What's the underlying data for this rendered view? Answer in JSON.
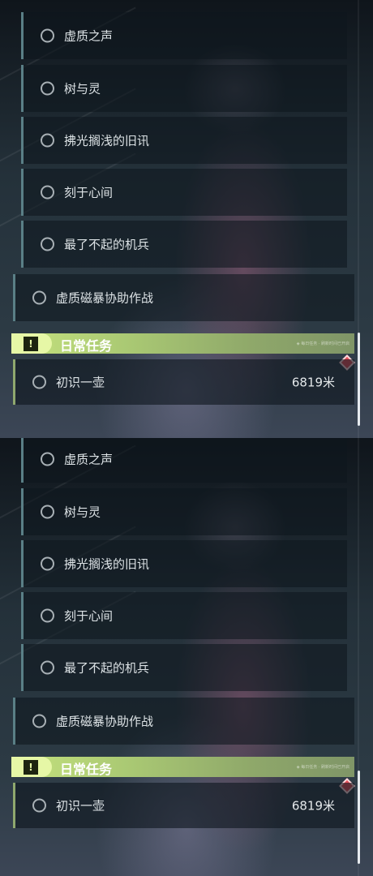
{
  "panels": [
    {
      "sub_quests": [
        {
          "label": "虚质之声"
        },
        {
          "label": "树与灵"
        },
        {
          "label": "拂光搁浅的旧讯"
        },
        {
          "label": "刻于心间"
        },
        {
          "label": "最了不起的机兵"
        }
      ],
      "main_quest": {
        "label": "虚质磁暴协助作战"
      },
      "daily": {
        "title": "日常任务",
        "icon_text": "!",
        "subtitle": "◈ 每日任务 · 刷新时间已开启"
      },
      "task": {
        "label": "初识一壶",
        "distance": "6819米"
      },
      "icons": {
        "status": "circle-icon",
        "daily": "exclamation-icon",
        "marker": "diamond-marker-icon"
      }
    },
    {
      "sub_quests": [
        {
          "label": "虚质之声"
        },
        {
          "label": "树与灵"
        },
        {
          "label": "拂光搁浅的旧讯"
        },
        {
          "label": "刻于心间"
        },
        {
          "label": "最了不起的机兵"
        }
      ],
      "main_quest": {
        "label": "虚质磁暴协助作战"
      },
      "daily": {
        "title": "日常任务",
        "icon_text": "!",
        "subtitle": "◈ 每日任务 · 刷新时间已开启"
      },
      "task": {
        "label": "初识一壶",
        "distance": "6819米"
      },
      "icons": {
        "status": "circle-icon",
        "daily": "exclamation-icon",
        "marker": "diamond-marker-icon"
      }
    }
  ],
  "colors": {
    "daily_accent": "#c5e27e",
    "marker": "#e4505a",
    "row_border": "#5a7f86"
  }
}
